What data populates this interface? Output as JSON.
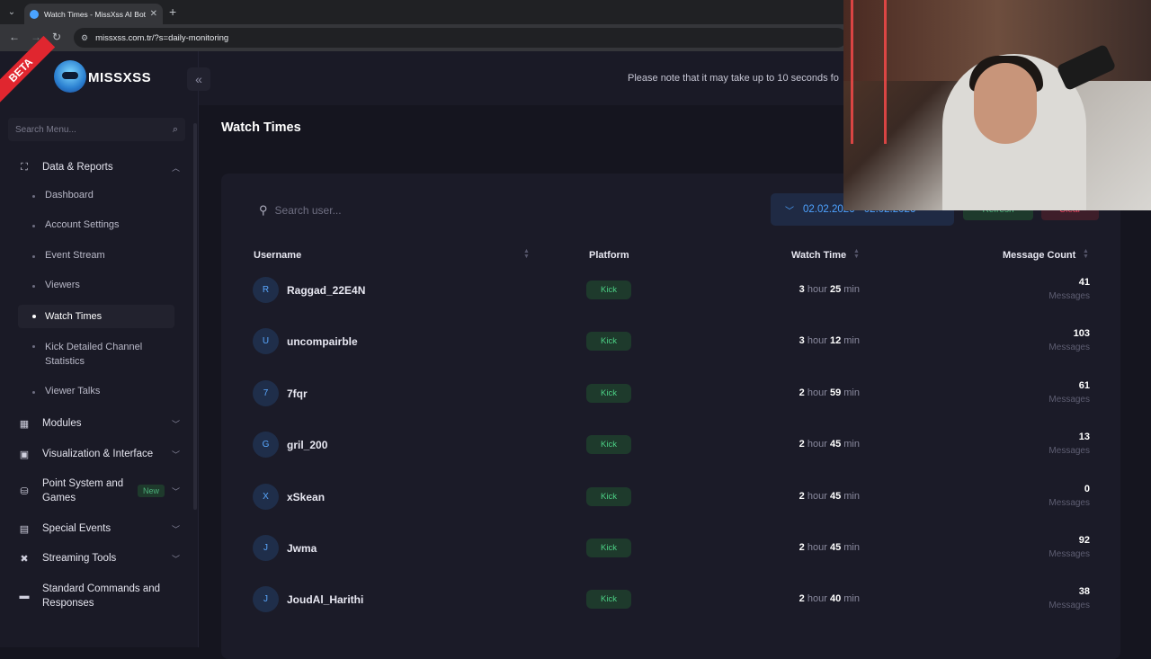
{
  "browser": {
    "tab_title": "Watch Times - MissXss AI Bot S",
    "url": "missxss.com.tr/?s=daily-monitoring"
  },
  "sidebar": {
    "beta": "BETA",
    "logo_text": "MISSXSS",
    "search_placeholder": "Search Menu...",
    "group_data": "Data & Reports",
    "items": [
      {
        "label": "Dashboard"
      },
      {
        "label": "Account Settings"
      },
      {
        "label": "Event Stream"
      },
      {
        "label": "Viewers"
      },
      {
        "label": "Watch Times"
      },
      {
        "label": "Kick Detailed Channel Statistics"
      },
      {
        "label": "Viewer Talks"
      }
    ],
    "groups": [
      {
        "label": "Modules"
      },
      {
        "label": "Visualization & Interface"
      },
      {
        "label": "Point System and Games",
        "badge": "New"
      },
      {
        "label": "Special Events"
      },
      {
        "label": "Streaming Tools"
      },
      {
        "label": "Standard Commands and Responses"
      }
    ]
  },
  "topbar": {
    "notice": "Please note that it may take up to 10 seconds fo"
  },
  "main": {
    "title": "Watch Times",
    "search_placeholder": "Search user...",
    "date_range": "02.02.2026 - 02.02.2026",
    "refresh_label": "Refresh",
    "clear_label": "Clear",
    "headers": {
      "username": "Username",
      "platform": "Platform",
      "watch_time": "Watch Time",
      "message_count": "Message Count"
    },
    "units": {
      "hour": "hour",
      "min": "min",
      "messages": "Messages"
    },
    "rows": [
      {
        "initial": "R",
        "username": "Raggad_22E4N",
        "platform": "Kick",
        "hours": "3",
        "mins": "25",
        "count": "41"
      },
      {
        "initial": "U",
        "username": "uncompairble",
        "platform": "Kick",
        "hours": "3",
        "mins": "12",
        "count": "103"
      },
      {
        "initial": "7",
        "username": "7fqr",
        "platform": "Kick",
        "hours": "2",
        "mins": "59",
        "count": "61"
      },
      {
        "initial": "G",
        "username": "gril_200",
        "platform": "Kick",
        "hours": "2",
        "mins": "45",
        "count": "13"
      },
      {
        "initial": "X",
        "username": "xSkean",
        "platform": "Kick",
        "hours": "2",
        "mins": "45",
        "count": "0"
      },
      {
        "initial": "J",
        "username": "Jwma",
        "platform": "Kick",
        "hours": "2",
        "mins": "45",
        "count": "92"
      },
      {
        "initial": "J",
        "username": "JoudAl_Harithi",
        "platform": "Kick",
        "hours": "2",
        "mins": "40",
        "count": "38"
      }
    ]
  }
}
